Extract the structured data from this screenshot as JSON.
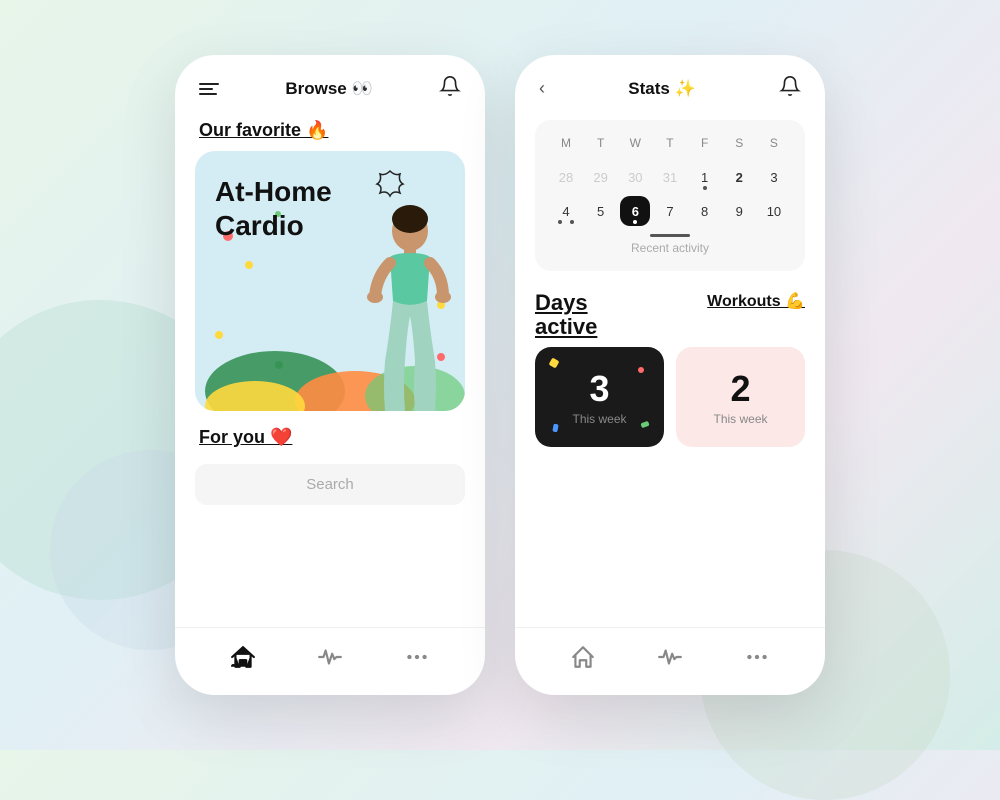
{
  "background": {
    "color": "#e8f5ec"
  },
  "phone1": {
    "header": {
      "title": "Browse 👀",
      "bell_label": "notifications"
    },
    "section1": {
      "label": "Our favorite 🔥"
    },
    "hero_card": {
      "title": "At-Home\nCardio"
    },
    "section2": {
      "label": "For you ❤️"
    },
    "search": {
      "placeholder": "Search"
    },
    "nav": {
      "items": [
        "home",
        "activity",
        "more"
      ]
    }
  },
  "phone2": {
    "header": {
      "title": "Stats ✨",
      "back_label": "back",
      "bell_label": "notifications"
    },
    "calendar": {
      "day_labels": [
        "M",
        "T",
        "W",
        "T",
        "F",
        "S",
        "S"
      ],
      "week1": [
        "28",
        "29",
        "30",
        "31",
        "1",
        "2",
        "3"
      ],
      "week2": [
        "4",
        "5",
        "6",
        "7",
        "8",
        "9",
        "10"
      ],
      "today": "6",
      "dots_row1": [
        false,
        false,
        false,
        false,
        true,
        true,
        false
      ],
      "dots_row2": [
        true,
        false,
        true,
        false,
        false,
        false,
        false
      ],
      "recent_activity_label": "Recent activity"
    },
    "stats": {
      "days_active_label": "Days\nactive",
      "workouts_label": "Workouts 💪",
      "card_dark": {
        "number": "3",
        "sublabel": "This week"
      },
      "card_light": {
        "number": "2",
        "sublabel": "This week"
      }
    },
    "nav": {
      "items": [
        "home",
        "activity",
        "more"
      ]
    }
  }
}
